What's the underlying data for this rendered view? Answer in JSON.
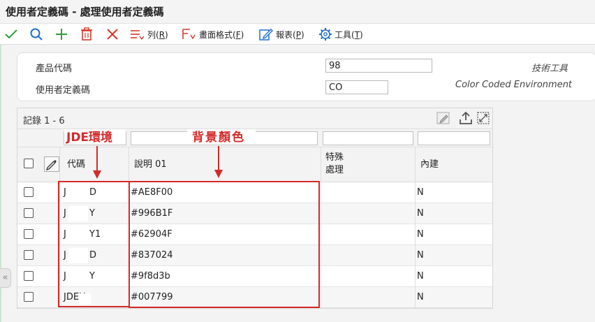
{
  "window": {
    "title": "使用者定義碼 - 處理使用者定義碼"
  },
  "toolbar": {
    "items": [
      {
        "icon": "checkmark-icon"
      },
      {
        "icon": "search-icon"
      },
      {
        "icon": "add-icon"
      },
      {
        "icon": "delete-icon"
      },
      {
        "icon": "close-icon"
      },
      {
        "icon": "columns-icon",
        "label": "列(",
        "key": "R",
        "tail": ")"
      },
      {
        "icon": "format-icon",
        "label": "畫面格式(",
        "key": "F",
        "tail": ")"
      },
      {
        "icon": "report-icon",
        "label": "報表(",
        "key": "P",
        "tail": ")"
      },
      {
        "icon": "gear-icon",
        "label": "工具(",
        "key": "T",
        "tail": ")"
      }
    ]
  },
  "form": {
    "product_code_label": "產品代碼",
    "product_code_value": "98",
    "product_code_desc": "技術工具",
    "udc_label": "使用者定義碼",
    "udc_value": "CO",
    "udc_desc": "Color Coded Environment"
  },
  "grid": {
    "record_count": "記錄 1 - 6",
    "columns": [
      "代碼",
      "說明 01",
      "特殊\n處理",
      "內建"
    ],
    "column_code": "代碼",
    "column_desc": "說明 01",
    "column_special_1": "特殊",
    "column_special_2": "處理",
    "column_builtin": "內建",
    "rows": [
      {
        "code_prefix": "J",
        "code_suffix": "D",
        "desc": "#AE8F00",
        "special": "",
        "builtin": "N"
      },
      {
        "code_prefix": "J",
        "code_suffix": "Y",
        "desc": "#996B1F",
        "special": "",
        "builtin": "N"
      },
      {
        "code_prefix": "J",
        "code_suffix": "Y1",
        "desc": "#62904F",
        "special": "",
        "builtin": "N"
      },
      {
        "code_prefix": "J",
        "code_suffix": "D",
        "desc": "#837024",
        "special": "",
        "builtin": "N"
      },
      {
        "code_prefix": "J",
        "code_suffix": "Y",
        "desc": "#9f8d3b",
        "special": "",
        "builtin": "N"
      },
      {
        "code_prefix": "JDEH",
        "code_suffix": "",
        "desc": "#007799",
        "special": "",
        "builtin": "N"
      }
    ]
  },
  "annotations": {
    "code_label": "JDE環境",
    "desc_label": "背景顏色",
    "color": "#d42a2a"
  },
  "colors": {
    "accent_green": "#2e9e3e",
    "toolbar_blue": "#1f6fd1",
    "delete_red": "#d33a2c"
  }
}
